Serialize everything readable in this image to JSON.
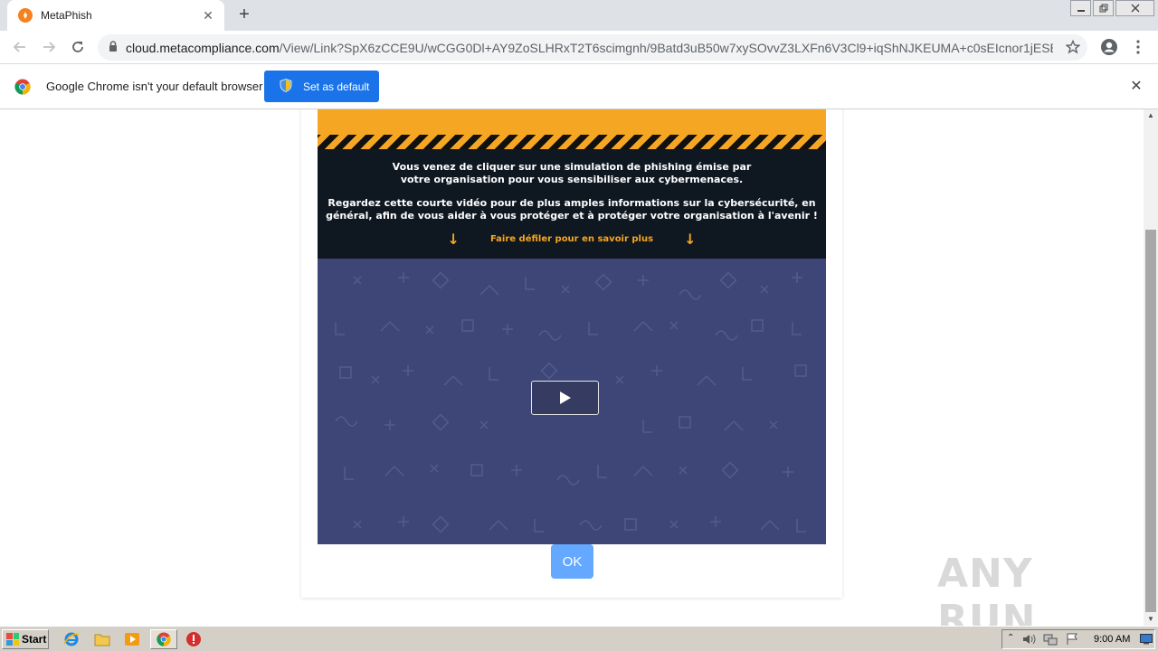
{
  "browser": {
    "tab": {
      "title": "MetaPhish"
    },
    "url": {
      "host": "cloud.metacompliance.com",
      "path": "/View/Link?SpX6zCCE9U/wCGG0Dl+AY9ZoSLHRxT2T6scimgnh/9Batd3uB50w7xySOvvZ3LXFn6V3Cl9+iqShNJKEUMA+c0sEIcnor1jESBF8..."
    },
    "infobar": {
      "message": "Google Chrome isn't your default browser",
      "button_label": "Set as default"
    }
  },
  "page": {
    "message_line1": "Vous venez de cliquer sur une simulation de phishing émise par votre organisation pour vous sensibiliser aux cybermenaces.",
    "message_line2": "Regardez cette courte vidéo pour de plus amples informations sur la cybersécurité, en général, afin de vous aider à vous protéger et à protéger votre organisation à l'avenir !",
    "scroll_hint": "Faire défiler pour en savoir plus",
    "ok_label": "OK",
    "watermark": "ANY RUN"
  },
  "taskbar": {
    "start_label": "Start",
    "clock": "9:00 AM"
  },
  "colors": {
    "orange": "#f5a623",
    "video_bg": "#3e4677",
    "ok_button": "#64a8ff",
    "chrome_blue": "#1a73e8"
  },
  "icons": [
    "metaphish-favicon",
    "close-icon",
    "new-tab-icon",
    "back-icon",
    "forward-icon",
    "reload-icon",
    "lock-icon",
    "star-icon",
    "profile-icon",
    "menu-icon",
    "chrome-logo-icon",
    "shield-icon",
    "play-icon",
    "ie-icon",
    "folder-icon",
    "media-player-icon",
    "chrome-icon",
    "stop-icon"
  ]
}
